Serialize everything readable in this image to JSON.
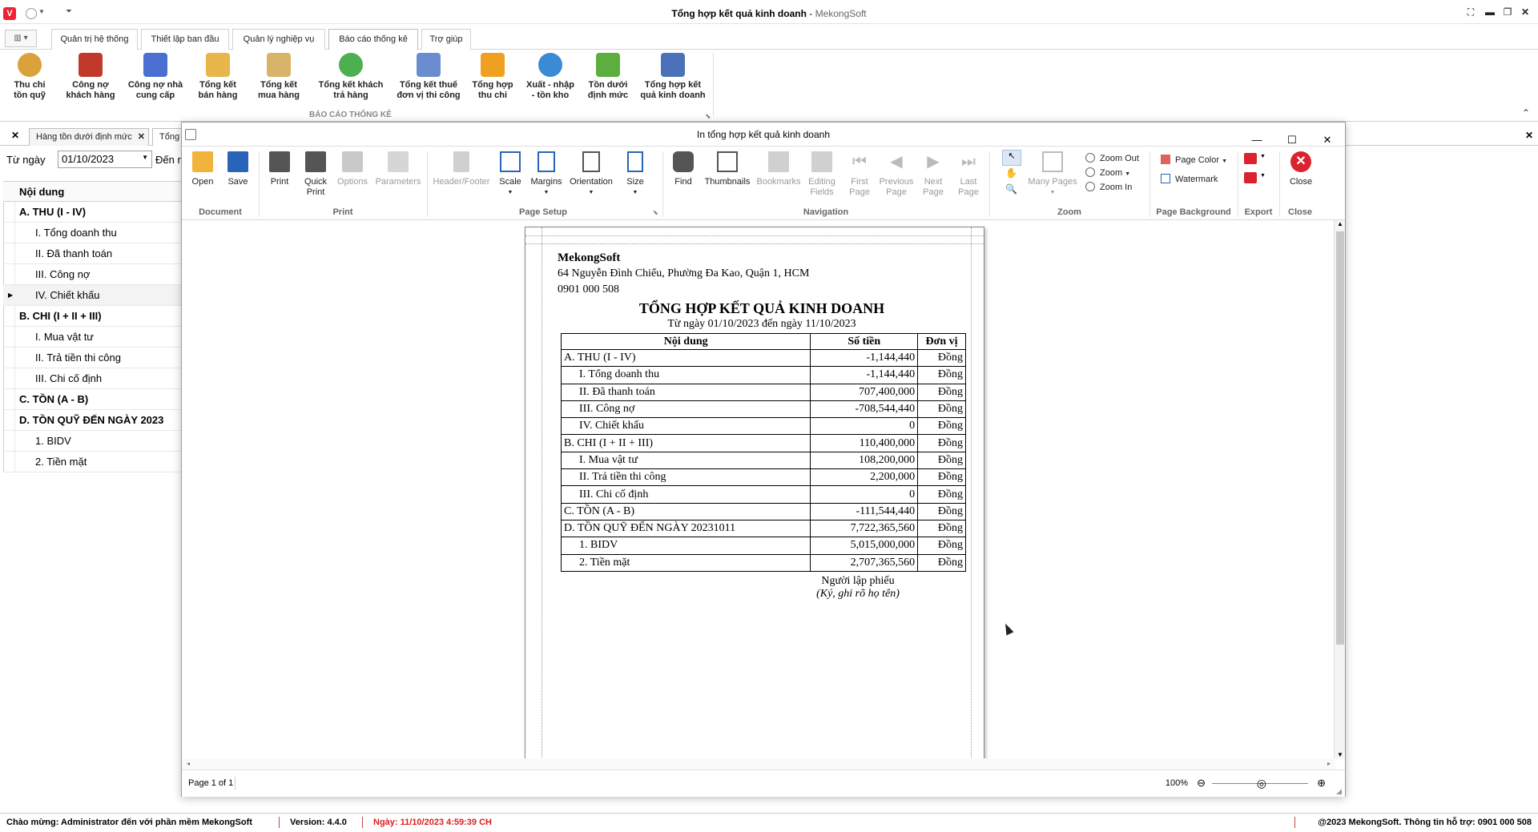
{
  "window": {
    "title_bold": "Tổng hợp kết quả kinh doanh",
    "title_sep": " - ",
    "title_app": "MekongSoft",
    "logo": "V"
  },
  "ribbon_tabs": [
    "Quản trị hệ thống",
    "Thiết lập ban đầu",
    "Quản lý nghiệp vụ",
    "Báo cáo thống kê",
    "Trợ giúp"
  ],
  "ribbon_buttons": [
    {
      "l1": "Thu chi",
      "l2": "tồn quỹ",
      "color": "#d9a23b"
    },
    {
      "l1": "Công nợ",
      "l2": "khách hàng",
      "color": "#c0392b"
    },
    {
      "l1": "Công nợ nhà",
      "l2": "cung cấp",
      "color": "#4a6fd1"
    },
    {
      "l1": "Tổng kết",
      "l2": "bán hàng",
      "color": "#e8b64a"
    },
    {
      "l1": "Tổng kết",
      "l2": "mua hàng",
      "color": "#d8b36a"
    },
    {
      "l1": "Tổng kết khách",
      "l2": "trả hàng",
      "color": "#4caf50"
    },
    {
      "l1": "Tổng kết thuế",
      "l2": "đơn vị thi công",
      "color": "#6b8ccf"
    },
    {
      "l1": "Tổng hợp",
      "l2": "thu chi",
      "color": "#f0a020"
    },
    {
      "l1": "Xuất - nhập",
      "l2": "- tồn kho",
      "color": "#3a8ad6"
    },
    {
      "l1": "Tồn dưới",
      "l2": "định mức",
      "color": "#5cae3f"
    },
    {
      "l1": "Tổng hợp kết",
      "l2": "quả kinh doanh",
      "color": "#4b72b8"
    }
  ],
  "ribbon_group_label": "BÁO CÁO THỐNG KÊ",
  "doc_tabs": [
    {
      "label": "Hàng tồn dưới định mức"
    },
    {
      "label": "Tổng h"
    }
  ],
  "filter": {
    "from_label": "Từ ngày",
    "from_value": "01/10/2023",
    "to_label": "Đến n"
  },
  "grid": {
    "header": "Nội dung",
    "rows": [
      {
        "text": "A. THU (I - IV)",
        "bold": true
      },
      {
        "text": "I. Tổng doanh thu",
        "bold": false
      },
      {
        "text": "II. Đã thanh toán",
        "bold": false
      },
      {
        "text": "III. Công nợ",
        "bold": false
      },
      {
        "text": "IV. Chiết khấu",
        "bold": false,
        "current": true
      },
      {
        "text": "B. CHI (I + II + III)",
        "bold": true
      },
      {
        "text": "I. Mua vật tư",
        "bold": false
      },
      {
        "text": "II. Trả tiền thi công",
        "bold": false
      },
      {
        "text": "III. Chi cố định",
        "bold": false
      },
      {
        "text": "C. TỒN (A - B)",
        "bold": true
      },
      {
        "text": "D. TỒN QUỸ ĐẾN NGÀY 2023",
        "bold": true
      },
      {
        "text": "1. BIDV",
        "bold": false
      },
      {
        "text": "2. Tiền mặt",
        "bold": false
      }
    ]
  },
  "dialog": {
    "title": "In tổng hợp kết quả kinh doanh",
    "toolbar": {
      "open": "Open",
      "save": "Save",
      "print": "Print",
      "quick_print_1": "Quick",
      "quick_print_2": "Print",
      "options": "Options",
      "parameters": "Parameters",
      "header_footer": "Header/Footer",
      "scale": "Scale",
      "margins": "Margins",
      "orientation": "Orientation",
      "size": "Size",
      "find": "Find",
      "thumbnails": "Thumbnails",
      "bookmarks": "Bookmarks",
      "editing_fields_1": "Editing",
      "editing_fields_2": "Fields",
      "first_page_1": "First",
      "first_page_2": "Page",
      "previous_page_1": "Previous",
      "previous_page_2": "Page",
      "next_page_1": "Next",
      "next_page_2": "Page",
      "last_page_1": "Last",
      "last_page_2": "Page",
      "many_pages": "Many Pages",
      "zoom_out": "Zoom Out",
      "zoom": "Zoom",
      "zoom_in": "Zoom In",
      "page_color": "Page Color",
      "watermark": "Watermark",
      "close": "Close"
    },
    "groups": {
      "document": "Document",
      "print": "Print",
      "page_setup": "Page Setup",
      "navigation": "Navigation",
      "zoom": "Zoom",
      "page_background": "Page Background",
      "export": "Export",
      "close": "Close"
    },
    "status": {
      "page": "Page 1 of 1",
      "zoom": "100%"
    }
  },
  "report": {
    "company": "MekongSoft",
    "address": "64 Nguyễn Đình Chiểu, Phường Đa Kao, Quận 1, HCM",
    "phone": "0901 000 508",
    "title": "TỔNG HỢP KẾT QUẢ KINH DOANH",
    "subtitle": "Từ ngày 01/10/2023 đến ngày 11/10/2023",
    "headers": [
      "Nội dung",
      "Số tiền",
      "Đơn vị"
    ],
    "rows": [
      {
        "label": "A. THU (I - IV)",
        "amount": "-1,144,440",
        "unit": "Đồng",
        "indent": false
      },
      {
        "label": "I. Tổng doanh thu",
        "amount": "-1,144,440",
        "unit": "Đồng",
        "indent": true
      },
      {
        "label": "II. Đã thanh toán",
        "amount": "707,400,000",
        "unit": "Đồng",
        "indent": true
      },
      {
        "label": "III. Công nợ",
        "amount": "-708,544,440",
        "unit": "Đồng",
        "indent": true
      },
      {
        "label": "IV. Chiết khấu",
        "amount": "0",
        "unit": "Đồng",
        "indent": true
      },
      {
        "label": "B. CHI (I + II + III)",
        "amount": "110,400,000",
        "unit": "Đồng",
        "indent": false
      },
      {
        "label": "I. Mua vật tư",
        "amount": "108,200,000",
        "unit": "Đồng",
        "indent": true
      },
      {
        "label": "II. Trả tiền thi công",
        "amount": "2,200,000",
        "unit": "Đồng",
        "indent": true
      },
      {
        "label": "III. Chi cố định",
        "amount": "0",
        "unit": "Đồng",
        "indent": true
      },
      {
        "label": "C. TỒN (A - B)",
        "amount": "-111,544,440",
        "unit": "Đồng",
        "indent": false
      },
      {
        "label": "D. TỒN QUỸ ĐẾN NGÀY 20231011",
        "amount": "7,722,365,560",
        "unit": "Đồng",
        "indent": false
      },
      {
        "label": "1. BIDV",
        "amount": "5,015,000,000",
        "unit": "Đồng",
        "indent": true
      },
      {
        "label": "2. Tiền mặt",
        "amount": "2,707,365,560",
        "unit": "Đồng",
        "indent": true
      }
    ],
    "signer": "Người lập phiếu",
    "signer_note": "(Ký, ghi rõ họ tên)"
  },
  "statusbar": {
    "welcome": "Chào mừng: Administrator đến với phần mềm MekongSoft",
    "version": "Version: 4.4.0",
    "date": "Ngày: 11/10/2023 4:59:39 CH",
    "copyright": "@2023 MekongSoft. Thông tin hỗ trợ: 0901 000 508"
  },
  "colors": {
    "date_red": "#d81e1e",
    "close_red": "#d9232e",
    "accent_blue": "#2a64b8"
  }
}
